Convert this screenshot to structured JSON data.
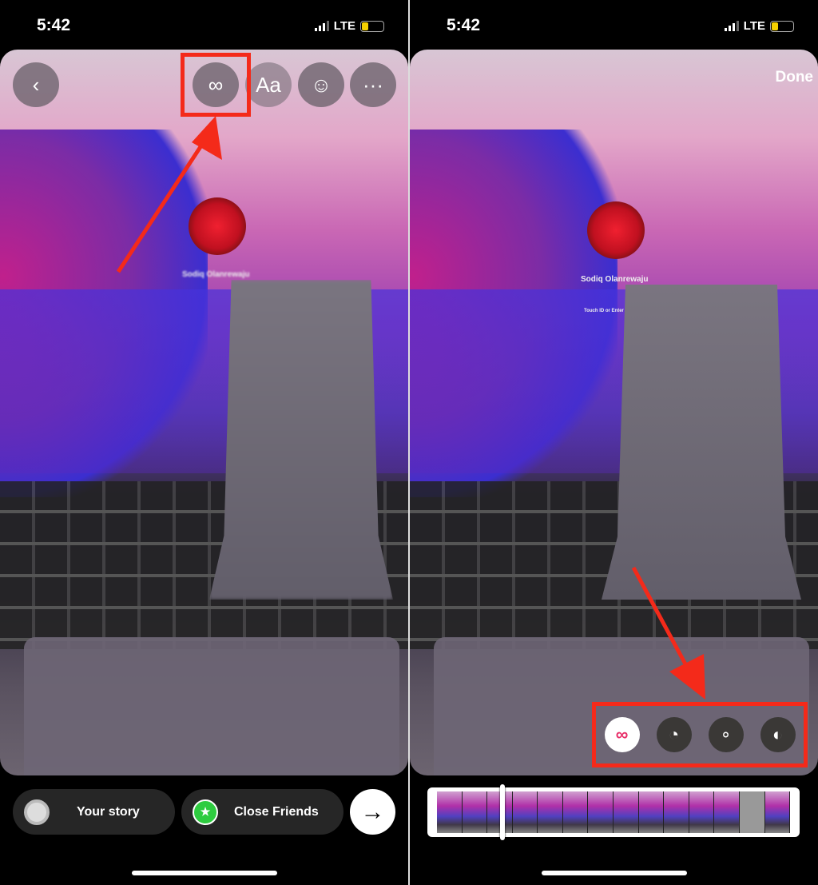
{
  "status_bar": {
    "time": "5:42",
    "network": "LTE"
  },
  "left": {
    "top_buttons": [
      {
        "name": "back",
        "glyph": "‹"
      },
      {
        "name": "boomerang",
        "glyph": "∞"
      },
      {
        "name": "text",
        "glyph": "Aa"
      },
      {
        "name": "sticker",
        "glyph": "☺"
      },
      {
        "name": "more",
        "glyph": "···"
      }
    ],
    "photo_text": {
      "name": "Sodiq Olanrewaju"
    },
    "share": {
      "your_story": "Your story",
      "close_friends": "Close Friends",
      "send_glyph": "→"
    }
  },
  "right": {
    "done_label": "Done",
    "photo_text": {
      "name": "Sodiq Olanrewaju",
      "hint": "Touch ID or Enter Password"
    },
    "effects": [
      {
        "name": "classic",
        "glyph": "∞",
        "selected": true
      },
      {
        "name": "slowmo",
        "glyph": "◔"
      },
      {
        "name": "echo",
        "glyph": "∘"
      },
      {
        "name": "duo",
        "glyph": "◐"
      }
    ]
  },
  "colors": {
    "highlight": "#f42a1a",
    "close_friends": "#2ecc40",
    "battery": "#f5d000"
  }
}
